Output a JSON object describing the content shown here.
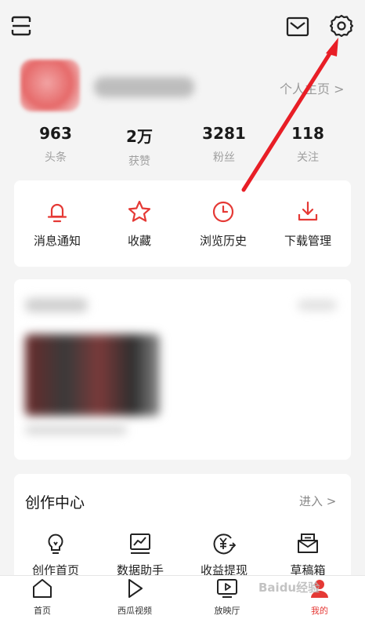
{
  "header": {
    "left_icon": "scan-icon",
    "mail_icon": "mail-icon",
    "settings_icon": "gear-icon"
  },
  "profile": {
    "homepage_link": "个人主页 >"
  },
  "stats": [
    {
      "value": "963",
      "label": "头条"
    },
    {
      "value": "2万",
      "label": "获赞"
    },
    {
      "value": "3281",
      "label": "粉丝"
    },
    {
      "value": "118",
      "label": "关注"
    }
  ],
  "quick_actions": [
    {
      "label": "消息通知",
      "icon": "bell-icon"
    },
    {
      "label": "收藏",
      "icon": "star-icon"
    },
    {
      "label": "浏览历史",
      "icon": "clock-icon"
    },
    {
      "label": "下载管理",
      "icon": "download-icon"
    }
  ],
  "creation": {
    "title": "创作中心",
    "enter": "进入 >",
    "tools": [
      {
        "label": "创作首页",
        "icon": "lightbulb-icon"
      },
      {
        "label": "数据助手",
        "icon": "chart-icon"
      },
      {
        "label": "收益提现",
        "icon": "yuan-icon"
      },
      {
        "label": "草稿箱",
        "icon": "drafts-icon"
      }
    ]
  },
  "tabs": [
    {
      "label": "首页",
      "icon": "home-icon"
    },
    {
      "label": "西瓜视频",
      "icon": "play-icon"
    },
    {
      "label": "放映厅",
      "icon": "tv-icon"
    },
    {
      "label": "我的",
      "icon": "profile-icon",
      "active": true
    }
  ],
  "watermark": "Baidu经验",
  "colors": {
    "accent": "#e53935",
    "background": "#f4f4f4"
  }
}
